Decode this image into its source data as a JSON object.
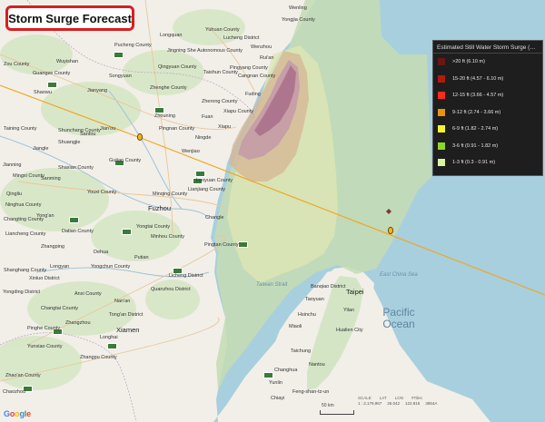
{
  "title": "Storm Surge Forecast",
  "legend": {
    "title": "Estimated Still Water Storm Surge (TA...",
    "items": [
      {
        "label": ">20 ft (6.10 m)",
        "color": "#6b1515"
      },
      {
        "label": "15-20 ft (4.57 - 6.10 m)",
        "color": "#b21a0c"
      },
      {
        "label": "12-15 ft (3.66 - 4.57 m)",
        "color": "#ff2a1c"
      },
      {
        "label": "9-12 ft (2.74 - 3.66 m)",
        "color": "#e9940e"
      },
      {
        "label": "6-9 ft (1.82 - 2.74 m)",
        "color": "#f4f430"
      },
      {
        "label": "3-6 ft (0.91 - 1.82 m)",
        "color": "#8fd62a"
      },
      {
        "label": "1-3 ft (0.3 - 0.91 m)",
        "color": "#d9f5a2"
      }
    ]
  },
  "map_labels": {
    "wenling": "Wenling",
    "yongjia": "Yongjia County",
    "yuhuan": "Yuhuan County",
    "longquan": "Longquan",
    "jingning": "Jingning She Autonomous County",
    "jinyun": "Jinyun County",
    "lucheng": "Lucheng District",
    "wenzhou": "Wenzhou",
    "ruian": "Rui'an",
    "pucheng": "Pucheng County",
    "songyuan": "Songyuan",
    "qingyuan": "Qingyuan County",
    "taishun": "Taishun County",
    "pingyang": "Pingyang County",
    "cangnan": "Cangnan County",
    "fuding": "Fuding",
    "zhenghe": "Zhenghe County",
    "zherong": "Zherong County",
    "fuan": "Fuan",
    "wuyishan": "Wuyishan",
    "jianyang": "Jianyang",
    "shaowu": "Shaowu",
    "zoucounty": "Zou County",
    "guangze": "Guangze County",
    "jianou": "Jian'ou",
    "sanfou": "Sanfou",
    "zhouning": "Zhouning",
    "pingnan": "Pingnan County",
    "ningde": "Ningde",
    "xiapu": "Xiapu",
    "shunchang": "Shunchang County",
    "shuangjie": "Shuangjie",
    "jiangle": "Jiangle",
    "shaxian": "Shaxian County",
    "sanming": "Sanming",
    "youxi": "Youxi County",
    "gutian": "Gutian County",
    "minqing": "Minqing County",
    "luoyuan": "Luoyuan County",
    "lianjiang": "Lianjiang County",
    "changle": "Changle",
    "pingtan": "Pingtan County",
    "fuzhou": "Fuzhou",
    "yongtai": "Yongtai County",
    "minhou": "Minhou County",
    "dehua": "Dehua",
    "yongchun": "Yongchun County",
    "putian": "Putian",
    "quanzhou": "Quanzhou District",
    "licheng": "Licheng District",
    "anxi": "Anxi County",
    "nan'an": "Nan'an",
    "tong'an": "Tong'an District",
    "xiamen": "Xiamen",
    "longhai": "Longhai",
    "zhangzhou": "Zhangzhou",
    "changtai": "Changtai County",
    "zhangpu": "Zhangpu County",
    "yunxiao": "Yunxiao County",
    "zhao'an": "Zhao'an County",
    "chaozhou": "Chaozhou",
    "pinghe": "Pinghe County",
    "shanghang": "Shanghang County",
    "yongding": "Yongding District",
    "xinluo": "Xinluo District",
    "longyan": "Longyan",
    "datian": "Datian County",
    "yong'an": "Yong'an",
    "zhangping": "Zhangping",
    "liancheng": "Liancheng County",
    "changting": "Changting County",
    "qingliu": "Qingliu",
    "ninghua": "Ninghua County",
    "mingxi": "Mingxi County",
    "jianning": "Jianning",
    "taining": "Taining County",
    "xiapu2": "Xiapu County",
    "wenjiao": "Wenjiao",
    "taiwan_strait": "Taiwan Strait",
    "east_china_sea": "East China Sea",
    "pacific": "Pacific Ocean",
    "banqiao": "Banqiao District",
    "taipei": "Taipei",
    "taoyuan": "Taoyuan",
    "hsinchu": "Hsinchu",
    "taichung": "Taichung",
    "hualien": "Hualien City",
    "changhua": "Changhua",
    "yunlin": "Yunlin",
    "chiayi": "Chiayi",
    "hengchun": "Feng-shan-tz-un",
    "yilan": "Yilan",
    "miaoli": "Miaoli",
    "nantou": "Nantou"
  },
  "scale": {
    "distance": "50 km",
    "labels": [
      "SCALE",
      "LAT",
      "LON",
      "#Tiles"
    ],
    "values": [
      "1 : 2,179,967",
      "26.042",
      "122.815",
      "3854A"
    ]
  },
  "logo": "Google",
  "logo_colors": [
    "#4285f4",
    "#ea4335",
    "#fbbc05",
    "#4285f4",
    "#34a853",
    "#ea4335"
  ],
  "colors": {
    "land": "#f2efe9",
    "sea": "#a8cfdd",
    "track": "#f2a51d",
    "fringe": "#c6dcb4"
  }
}
